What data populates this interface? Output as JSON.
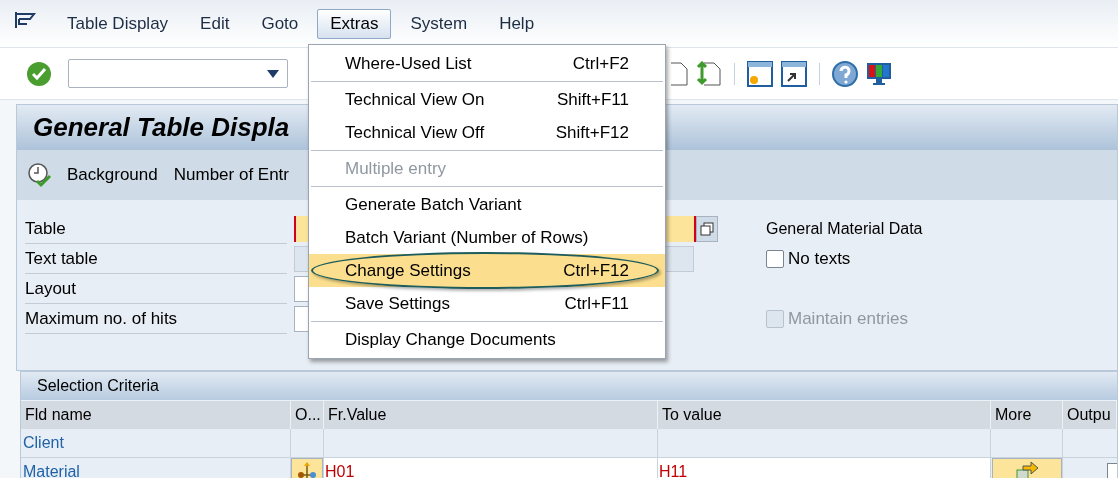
{
  "menu_bar": [
    {
      "label": "Table Display",
      "selected": false
    },
    {
      "label": "Edit",
      "selected": false
    },
    {
      "label": "Goto",
      "selected": false
    },
    {
      "label": "Extras",
      "selected": true
    },
    {
      "label": "System",
      "selected": false
    },
    {
      "label": "Help",
      "selected": false
    }
  ],
  "title": "General Table Displa",
  "app_toolbar": [
    {
      "label": "Background",
      "kind": "icon"
    },
    {
      "label": "Number of Entr",
      "kind": "text"
    }
  ],
  "form": {
    "rows": [
      {
        "label": "Table",
        "kind": "required"
      },
      {
        "label": "Text table",
        "kind": "readonly"
      },
      {
        "label": "Layout",
        "kind": "input"
      },
      {
        "label": "Maximum no. of hits",
        "kind": "input"
      }
    ],
    "description": "General Material Data",
    "checkboxes": [
      {
        "label": "No texts",
        "checked": false,
        "disabled": false
      },
      {
        "label": "Maintain entries",
        "checked": false,
        "disabled": true
      }
    ]
  },
  "selection_criteria": {
    "title": "Selection Criteria",
    "columns": [
      "Fld name",
      "O...",
      "Fr.Value",
      "To value",
      "More",
      "Outpu"
    ],
    "rows": [
      {
        "field": "Client"
      },
      {
        "field": "Material",
        "from": "H01",
        "to": "H11",
        "output": false
      }
    ]
  },
  "menu": [
    {
      "kind": "item",
      "label": "Where-Used List",
      "shortcut": "Ctrl+F2",
      "selected": false,
      "disabled": false
    },
    {
      "kind": "separator"
    },
    {
      "kind": "item",
      "label": "Technical View On",
      "shortcut": "Shift+F11",
      "selected": false,
      "disabled": false
    },
    {
      "kind": "item",
      "label": "Technical View Off",
      "shortcut": "Shift+F12",
      "selected": false,
      "disabled": false
    },
    {
      "kind": "separator"
    },
    {
      "kind": "item",
      "label": "Multiple entry",
      "selected": false,
      "disabled": true
    },
    {
      "kind": "separator"
    },
    {
      "kind": "item",
      "label": "Generate Batch Variant",
      "selected": false,
      "disabled": false
    },
    {
      "kind": "item",
      "label": "Batch Variant (Number of Rows)",
      "selected": false,
      "disabled": false
    },
    {
      "kind": "item",
      "label": "Change Settings",
      "shortcut": "Ctrl+F12",
      "selected": true,
      "disabled": false
    },
    {
      "kind": "item",
      "label": "Save Settings",
      "shortcut": "Ctrl+F11",
      "selected": false,
      "disabled": false
    },
    {
      "kind": "separator"
    },
    {
      "kind": "item",
      "label": "Display Change Documents",
      "selected": false,
      "disabled": false
    }
  ]
}
